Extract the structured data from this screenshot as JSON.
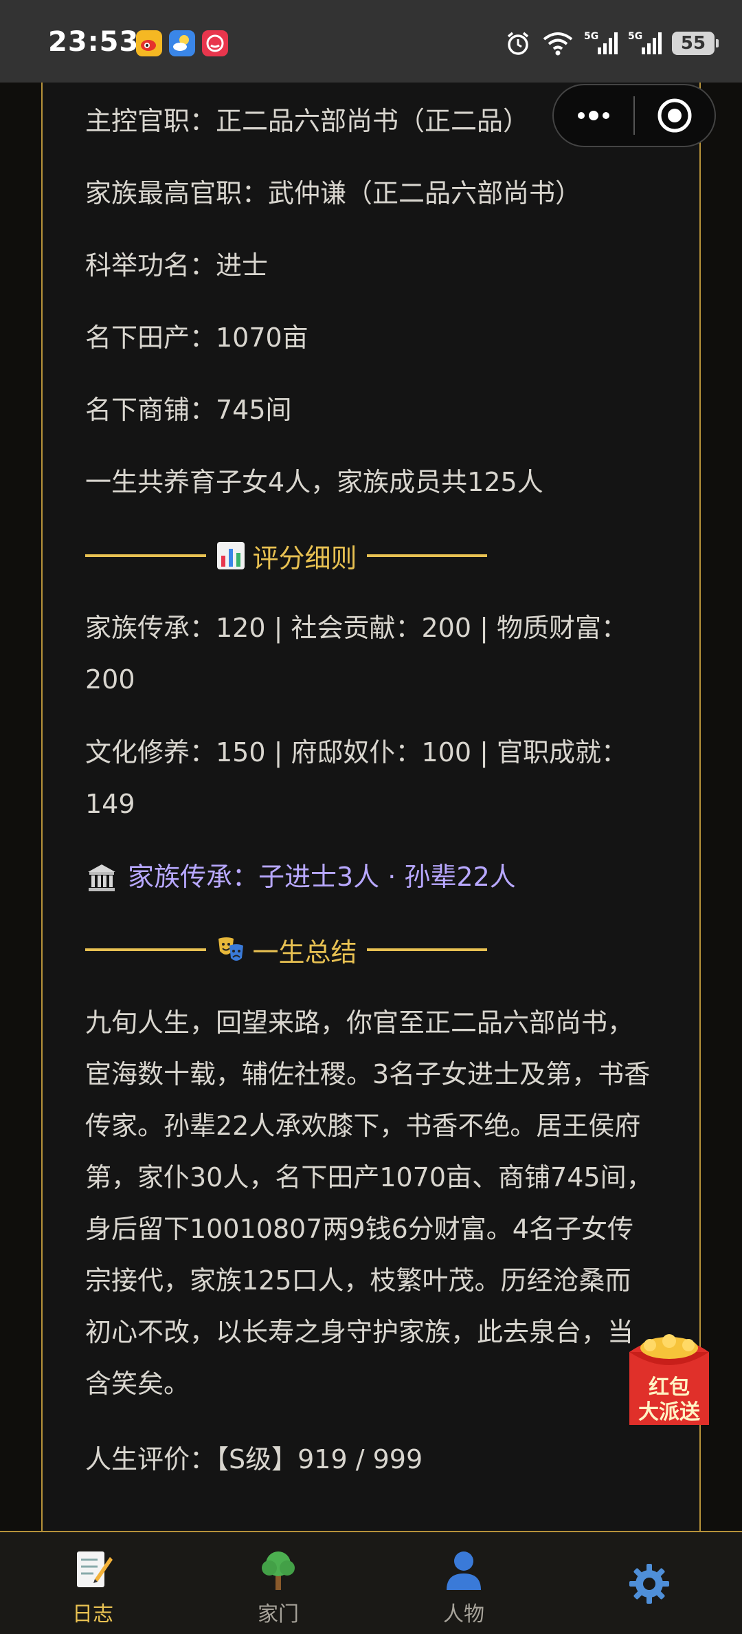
{
  "status_bar": {
    "time": "23:53",
    "battery": "55",
    "network_1": "5G",
    "network_2": "5G",
    "notification_icons": [
      "weibo-icon",
      "weather-icon",
      "app-icon"
    ]
  },
  "capsule": {
    "menu_icon": "more-icon",
    "close_icon": "target-icon"
  },
  "content": {
    "lines": [
      "主控官职：正二品六部尚书（正二品）",
      "家族最高官职：武仲谦（正二品六部尚书）",
      "科举功名：进士",
      "名下田产：1070亩",
      "名下商铺：745间",
      "一生共养育子女4人，家族成员共125人"
    ],
    "score_section_title": "评分细则",
    "score_line_1": "家族传承：120 | 社会贡献：200 | 物质财富：200",
    "score_line_2": "文化修养：150 | 府邸奴仆：100 | 官职成就：149",
    "heritage": "家族传承：子进士3人 · 孙辈22人",
    "summary_section_title": "一生总结",
    "summary": "九旬人生，回望来路，你官至正二品六部尚书，宦海数十载，辅佐社稷。3名子女进士及第，书香传家。孙辈22人承欢膝下，书香不绝。居王侯府第，家仆30人，名下田产1070亩、商铺745间，身后留下10010807两9钱6分财富。4名子女传宗接代，家族125口人，枝繁叶茂。历经沧桑而初心不改，以长寿之身守护家族，此去泉台，当含笑矣。",
    "rating": "人生评价：【S级】919 / 999"
  },
  "red_packet": {
    "line1": "红包",
    "line2": "大派送"
  },
  "nav": {
    "items": [
      {
        "label": "日志",
        "icon": "memo-icon",
        "active": true
      },
      {
        "label": "家门",
        "icon": "tree-icon",
        "active": false
      },
      {
        "label": "人物",
        "icon": "person-icon",
        "active": false
      },
      {
        "label": "",
        "icon": "gear-icon",
        "active": false
      }
    ]
  },
  "colors": {
    "accent": "#e8c152",
    "purple": "#b8a8ff",
    "text": "#d9d6cf",
    "background": "#141414"
  }
}
